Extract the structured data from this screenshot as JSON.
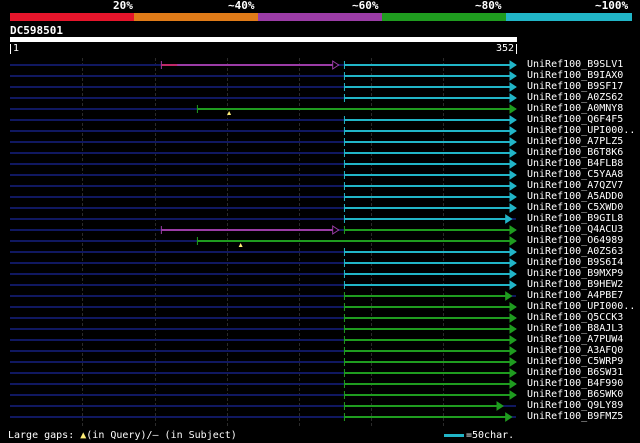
{
  "legend": {
    "items": [
      {
        "label": "20%",
        "color": "#e6152b"
      },
      {
        "label": "~40%",
        "color": "#e07b18"
      },
      {
        "label": "~60%",
        "color": "#9b3ca6"
      },
      {
        "label": "~80%",
        "color": "#1f9c1f"
      },
      {
        "label": "~100%",
        "color": "#21b5c7"
      }
    ]
  },
  "query": {
    "id": "DC598501",
    "start_label": "1",
    "end_label": "352",
    "length": 352
  },
  "hits": [
    {
      "label": "UniRef100_B9SLV1",
      "color": "#9b3ca6",
      "start": 106,
      "end": 229,
      "gap_at": 117,
      "tail_start": 233,
      "tail_color": "#21b5c7"
    },
    {
      "label": "UniRef100_B9IAX0",
      "color": "#21b5c7",
      "start": 233,
      "end": 352
    },
    {
      "label": "UniRef100_B9SF17",
      "color": "#21b5c7",
      "start": 233,
      "end": 352
    },
    {
      "label": "UniRef100_A0ZS62",
      "color": "#21b5c7",
      "start": 233,
      "end": 352
    },
    {
      "label": "UniRef100_A0MNY8",
      "color": "#1f9c1f",
      "start": 131,
      "end": 352,
      "query_gap": 153
    },
    {
      "label": "UniRef100_Q6F4F5",
      "color": "#21b5c7",
      "start": 233,
      "end": 352
    },
    {
      "label": "UniRef100_UPI000..",
      "color": "#21b5c7",
      "start": 233,
      "end": 352
    },
    {
      "label": "UniRef100_A7PLZ5",
      "color": "#21b5c7",
      "start": 233,
      "end": 352
    },
    {
      "label": "UniRef100_B6T8K6",
      "color": "#21b5c7",
      "start": 233,
      "end": 352
    },
    {
      "label": "UniRef100_B4FLB8",
      "color": "#21b5c7",
      "start": 233,
      "end": 352
    },
    {
      "label": "UniRef100_C5YAA8",
      "color": "#21b5c7",
      "start": 233,
      "end": 352
    },
    {
      "label": "UniRef100_A7QZV7",
      "color": "#21b5c7",
      "start": 233,
      "end": 352
    },
    {
      "label": "UniRef100_A5ADD0",
      "color": "#21b5c7",
      "start": 233,
      "end": 352
    },
    {
      "label": "UniRef100_C5XWD0",
      "color": "#21b5c7",
      "start": 233,
      "end": 352
    },
    {
      "label": "UniRef100_B9GIL8",
      "color": "#21b5c7",
      "start": 233,
      "end": 349
    },
    {
      "label": "UniRef100_Q4ACU3",
      "color": "#9b3ca6",
      "start": 106,
      "end": 229,
      "tail_start": 233,
      "tail_color": "#1f9c1f"
    },
    {
      "label": "UniRef100_O64989",
      "color": "#1f9c1f",
      "start": 131,
      "end": 352,
      "query_gap": 161
    },
    {
      "label": "UniRef100_A0ZS63",
      "color": "#21b5c7",
      "start": 233,
      "end": 352
    },
    {
      "label": "UniRef100_B9S6I4",
      "color": "#21b5c7",
      "start": 233,
      "end": 352
    },
    {
      "label": "UniRef100_B9MXP9",
      "color": "#21b5c7",
      "start": 233,
      "end": 352
    },
    {
      "label": "UniRef100_B9HEW2",
      "color": "#21b5c7",
      "start": 233,
      "end": 352
    },
    {
      "label": "UniRef100_A4PBE7",
      "color": "#1f9c1f",
      "start": 233,
      "end": 349
    },
    {
      "label": "UniRef100_UPI000..",
      "color": "#1f9c1f",
      "start": 233,
      "end": 352
    },
    {
      "label": "UniRef100_Q5CCK3",
      "color": "#1f9c1f",
      "start": 233,
      "end": 352
    },
    {
      "label": "UniRef100_B8AJL3",
      "color": "#1f9c1f",
      "start": 233,
      "end": 352
    },
    {
      "label": "UniRef100_A7PUW4",
      "color": "#1f9c1f",
      "start": 233,
      "end": 352
    },
    {
      "label": "UniRef100_A3AFQ0",
      "color": "#1f9c1f",
      "start": 233,
      "end": 352
    },
    {
      "label": "UniRef100_C5WRP9",
      "color": "#1f9c1f",
      "start": 233,
      "end": 352
    },
    {
      "label": "UniRef100_B6SW31",
      "color": "#1f9c1f",
      "start": 233,
      "end": 352
    },
    {
      "label": "UniRef100_B4F990",
      "color": "#1f9c1f",
      "start": 233,
      "end": 352
    },
    {
      "label": "UniRef100_B6SWK0",
      "color": "#1f9c1f",
      "start": 233,
      "end": 352
    },
    {
      "label": "UniRef100_Q9LY89",
      "color": "#1f9c1f",
      "start": 233,
      "end": 343
    },
    {
      "label": "UniRef100_B9FMZ5",
      "color": "#1f9c1f",
      "start": 233,
      "end": 349
    }
  ],
  "footer": {
    "gaps_prefix": "Large gaps: ",
    "gaps_query_glyph": "▲",
    "gaps_query_text": "(in Query)/",
    "gaps_subject_text": "– (in Subject)",
    "scale_text": "=50char."
  }
}
